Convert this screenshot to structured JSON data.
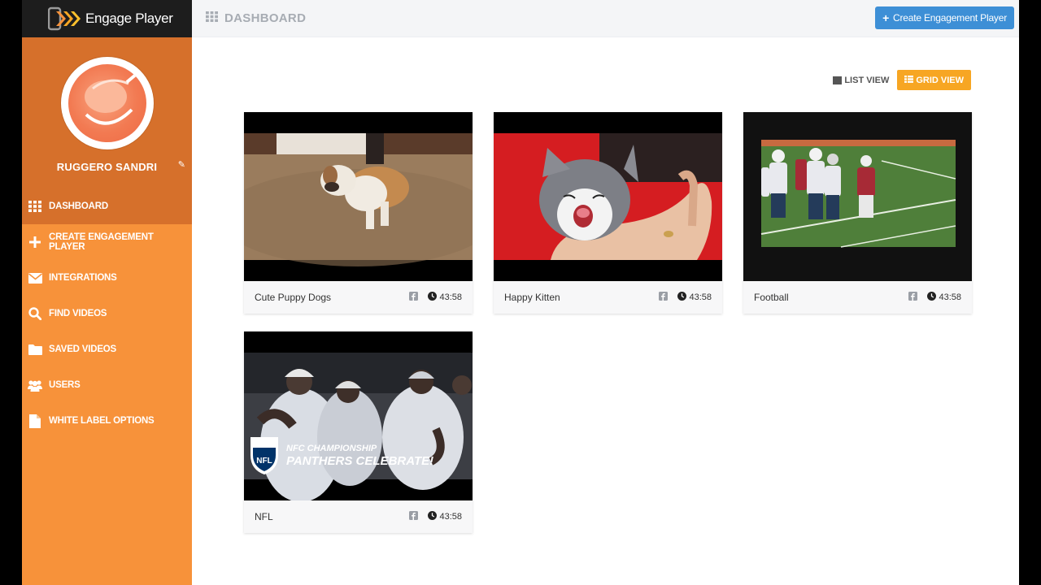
{
  "app": {
    "brand": "Engage Player"
  },
  "user": {
    "name": "RUGGERO SANDRI"
  },
  "sidebar": {
    "items": [
      {
        "label": "DASHBOARD",
        "icon": "grid-icon",
        "active": true
      },
      {
        "label": "CREATE ENGAGEMENT PLAYER",
        "icon": "plus-icon",
        "active": false
      },
      {
        "label": "INTEGRATIONS",
        "icon": "envelope-icon",
        "active": false
      },
      {
        "label": "FIND VIDEOS",
        "icon": "search-icon",
        "active": false
      },
      {
        "label": "SAVED VIDEOS",
        "icon": "folder-icon",
        "active": false
      },
      {
        "label": "USERS",
        "icon": "users-icon",
        "active": false
      },
      {
        "label": "WHITE LABEL OPTIONS",
        "icon": "document-icon",
        "active": false
      }
    ]
  },
  "header": {
    "title": "DASHBOARD",
    "create_button": "Create Engagement Player"
  },
  "view": {
    "list_label": "LIST VIEW",
    "grid_label": "GRID VIEW",
    "selected": "grid"
  },
  "videos": [
    {
      "title": "Cute Puppy Dogs",
      "duration": "43:58"
    },
    {
      "title": "Happy Kitten",
      "duration": "43:58"
    },
    {
      "title": "Football",
      "duration": "43:58"
    },
    {
      "title": "NFL",
      "duration": "43:58",
      "overlay_line1": "NFC CHAMPIONSHIP",
      "overlay_line2": "PANTHERS CELEBRATE!",
      "logo_text": "NFL"
    }
  ],
  "colors": {
    "sidebar_bg": "#f7923a",
    "sidebar_active": "#d6702b",
    "brand_bar": "#1d1d1d",
    "primary_button": "#3d8fd6",
    "grid_toggle": "#f7a623"
  }
}
